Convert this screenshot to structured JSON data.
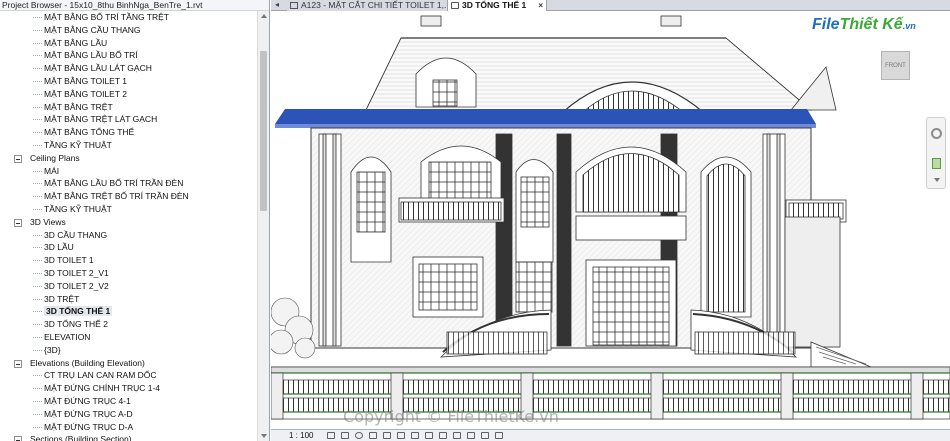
{
  "project_browser": {
    "title": "Project Browser - 15x10_8thu BinhNga_BenTre_1.rvt",
    "rows": [
      {
        "kind": "leaf",
        "label": "MẶT BẰNG BỐ TRÍ TẦNG TRỆT"
      },
      {
        "kind": "leaf",
        "label": "MẶT BẰNG CẦU THANG"
      },
      {
        "kind": "leaf",
        "label": "MẶT BẰNG LẦU"
      },
      {
        "kind": "leaf",
        "label": "MẶT BẰNG LẦU BỐ TRÍ"
      },
      {
        "kind": "leaf",
        "label": "MẶT BẰNG LẦU LÁT GẠCH"
      },
      {
        "kind": "leaf",
        "label": "MẶT BẰNG TOILET 1"
      },
      {
        "kind": "leaf",
        "label": "MẶT BẰNG TOILET 2"
      },
      {
        "kind": "leaf",
        "label": "MẶT BẰNG TRỆT"
      },
      {
        "kind": "leaf",
        "label": "MẶT BẰNG TRỆT LÁT GẠCH"
      },
      {
        "kind": "leaf",
        "label": "MẶT BẰNG TỔNG THỂ"
      },
      {
        "kind": "leaf",
        "label": "TẦNG KỸ THUẬT"
      },
      {
        "kind": "group",
        "label": "Ceiling Plans"
      },
      {
        "kind": "leaf",
        "label": "MÁI"
      },
      {
        "kind": "leaf",
        "label": "MẶT BẰNG LẦU BỐ TRÍ TRẦN ĐÈN"
      },
      {
        "kind": "leaf",
        "label": "MẶT BẰNG TRỆT BỐ TRÍ TRẦN ĐÈN"
      },
      {
        "kind": "leaf",
        "label": "TẦNG KỸ THUẬT"
      },
      {
        "kind": "group",
        "label": "3D Views"
      },
      {
        "kind": "leaf",
        "label": "3D CẦU THANG"
      },
      {
        "kind": "leaf",
        "label": "3D LẦU"
      },
      {
        "kind": "leaf",
        "label": "3D TOILET 1"
      },
      {
        "kind": "leaf",
        "label": "3D TOILET 2_V1"
      },
      {
        "kind": "leaf",
        "label": "3D TOILET 2_V2"
      },
      {
        "kind": "leaf",
        "label": "3D TRỆT"
      },
      {
        "kind": "leaf",
        "label": "3D TỔNG THỂ 1",
        "selected": true
      },
      {
        "kind": "leaf",
        "label": "3D TỔNG THỂ 2"
      },
      {
        "kind": "leaf",
        "label": "ELEVATION"
      },
      {
        "kind": "leaf",
        "label": "{3D}"
      },
      {
        "kind": "group",
        "label": "Elevations (Building Elevation)"
      },
      {
        "kind": "leaf",
        "label": "CT TRỤ LAN CAN RAM DỐC"
      },
      {
        "kind": "leaf",
        "label": "MẶT ĐỨNG CHÍNH TRỤC 1-4"
      },
      {
        "kind": "leaf",
        "label": "MẶT ĐỨNG TRỤC 4-1"
      },
      {
        "kind": "leaf",
        "label": "MẶT ĐỨNG TRỤC A-D"
      },
      {
        "kind": "leaf",
        "label": "MẶT ĐỨNG TRỤC D-A"
      },
      {
        "kind": "group",
        "label": "Sections (Building Section)"
      }
    ]
  },
  "tabs": [
    {
      "label": "A123 - MẶT CẮT CHI TIẾT TOILET 1,...",
      "close": "×",
      "active": false
    },
    {
      "label": "3D TỔNG THỂ 1",
      "close": "×",
      "active": true
    }
  ],
  "viewcube_label": "FRONT",
  "logo": {
    "part1": "File",
    "part2": "Thiết Kế",
    "suffix": ".vn"
  },
  "watermark": "Copyright © FileThietKe.vn",
  "status": {
    "scale": "1 : 100"
  },
  "colors": {
    "selected_roof_edge": "#2c53b8",
    "browser_border": "#9aa3ad"
  }
}
